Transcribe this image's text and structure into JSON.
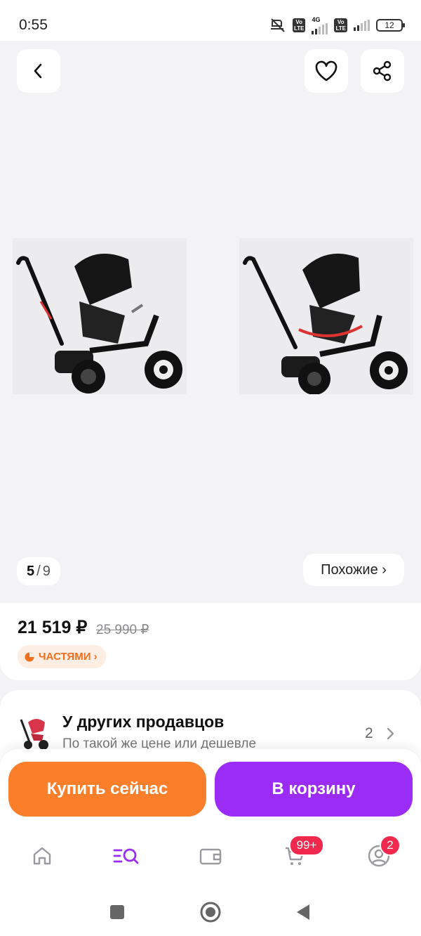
{
  "status_bar": {
    "time": "0:55",
    "network_1": "4G",
    "battery": "12"
  },
  "gallery": {
    "current_image": "5",
    "separator": "/",
    "total_images": "9",
    "similar_label": "Похожие ›"
  },
  "product": {
    "price": "21 519 ₽",
    "old_price": "25 990 ₽",
    "installments_label": "ЧАСТЯМИ ›"
  },
  "other_sellers": {
    "title": "У других продавцов",
    "subtitle": "По такой же цене или дешевле",
    "count": "2"
  },
  "actions": {
    "buy_now": "Купить сейчас",
    "add_to_cart": "В корзину"
  },
  "bottom_nav": {
    "cart_badge": "99+",
    "profile_badge": "2"
  },
  "colors": {
    "accent_orange": "#fb7f2a",
    "accent_purple": "#9b2cf5",
    "badge_red": "#f2294e",
    "installments_orange": "#f06e1c"
  }
}
